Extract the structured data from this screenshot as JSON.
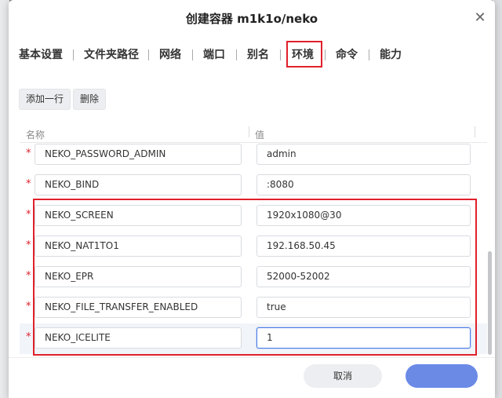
{
  "dialog": {
    "title": "创建容器 m1k1o/neko"
  },
  "tabs": [
    {
      "label": "基本设置",
      "active": false
    },
    {
      "label": "文件夹路径",
      "active": false
    },
    {
      "label": "网络",
      "active": false
    },
    {
      "label": "端口",
      "active": false
    },
    {
      "label": "别名",
      "active": false
    },
    {
      "label": "环境",
      "active": true
    },
    {
      "label": "命令",
      "active": false
    },
    {
      "label": "能力",
      "active": false
    }
  ],
  "toolbar": {
    "add_row_label": "添加一行",
    "delete_label": "删除"
  },
  "table": {
    "headers": {
      "name": "名称",
      "value": "值"
    },
    "required_mark": "*",
    "rows": [
      {
        "name": "NEKO_PASSWORD_ADMIN",
        "value": "admin"
      },
      {
        "name": "NEKO_BIND",
        "value": ":8080"
      },
      {
        "name": "NEKO_SCREEN",
        "value": "1920x1080@30"
      },
      {
        "name": "NEKO_NAT1TO1",
        "value": "192.168.50.45"
      },
      {
        "name": "NEKO_EPR",
        "value": "52000-52002"
      },
      {
        "name": "NEKO_FILE_TRANSFER_ENABLED",
        "value": "true"
      },
      {
        "name": "NEKO_ICELITE",
        "value": "1"
      }
    ]
  },
  "footer": {
    "cancel_label": "取消",
    "primary_label": ""
  },
  "colors": {
    "highlight": "#e0202a",
    "primary": "#6b8ae6",
    "focus": "#4a7be8"
  },
  "icons": {
    "close": "close-icon"
  }
}
